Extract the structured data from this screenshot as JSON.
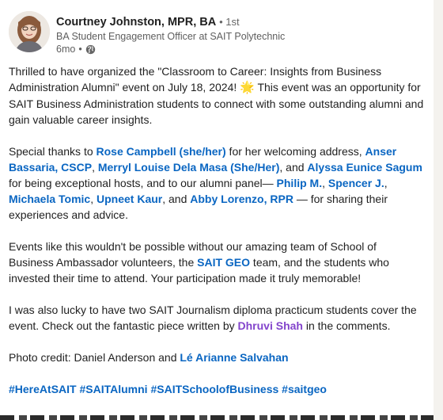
{
  "author": {
    "name": "Courtney Johnston, MPR, BA",
    "connection": "1st",
    "headline": "BA Student Engagement Officer at SAIT Polytechnic",
    "age": "6mo",
    "visibility_icon": "globe-icon"
  },
  "post": {
    "p1": {
      "t1": "Thrilled to have organized the \"Classroom to Career: Insights from Business Administration Alumni\" event on July 18, 2024! ",
      "emoji": "🌟",
      "t2": " This event was an opportunity for SAIT Business Administration students to connect with some outstanding alumni and gain valuable career insights."
    },
    "p2": {
      "t1": "Special thanks to ",
      "m1": "Rose Campbell (she/her)",
      "t2": " for her welcoming address, ",
      "m2": "Anser Bassaria, CSCP",
      "t3": ", ",
      "m3": "Merryl Louise Dela Masa (She/Her)",
      "t4": ", and ",
      "m4": "Alyssa Eunice Sagum",
      "t5": " for being exceptional hosts, and to our alumni panel— ",
      "m5": "Philip M.",
      "t6": ", ",
      "m6": "Spencer J.",
      "t7": ", ",
      "m7": "Michaela Tomic",
      "t8": ", ",
      "m8": "Upneet Kaur",
      "t9": ", and ",
      "m9": "Abby Lorenzo, RPR",
      "t10": " — for sharing their experiences and advice."
    },
    "p3": {
      "t1": "Events like this wouldn't be possible without our amazing team of School of Business Ambassador volunteers, the ",
      "m1": "SAIT GEO",
      "t2": " team, and the students who invested their time to attend. Your participation made it truly memorable!"
    },
    "p4": {
      "t1": "I was also lucky to have two SAIT Journalism diploma practicum students cover the event. Check out the fantastic piece written by ",
      "m1": "Dhruvi Shah",
      "t2": " in the comments."
    },
    "p5": {
      "t1": "Photo credit: Daniel Anderson and ",
      "m1": "Lé Arianne Salvahan"
    },
    "hashtags": [
      "#HereAtSAIT",
      "#SAITAlumni",
      "#SAITSchoolofBusiness",
      "#saitgeo"
    ]
  },
  "colors": {
    "link": "#0a66c2",
    "mention_highlight": "#8344cc",
    "text": "#1f1f1f",
    "muted": "#5e5e5e"
  }
}
